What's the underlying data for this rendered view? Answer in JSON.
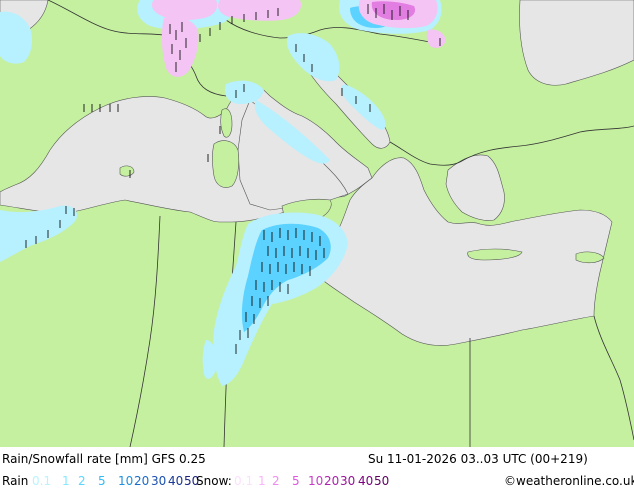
{
  "header": {
    "title": "Rain/Snowfall rate [mm] GFS 0.25",
    "datetime": "Su 11-01-2026 03..03 UTC (00+219)"
  },
  "legend": {
    "rain_label": "Rain",
    "rain_values": [
      "0.1",
      "1",
      "2",
      "5",
      "10",
      "20",
      "30",
      "40",
      "50"
    ],
    "rain_colors": [
      "#b8f4ff",
      "#8ae8ff",
      "#5cd6ff",
      "#33bbf5",
      "#1e90e0",
      "#1a6ccc",
      "#1a4fb0",
      "#1a3896",
      "#1a237e"
    ],
    "snow_label": "Snow:",
    "snow_values": [
      "0.1",
      "1",
      "2",
      "5",
      "10",
      "20",
      "30",
      "40",
      "50"
    ],
    "snow_colors": [
      "#fde0fd",
      "#f7b6f7",
      "#f08cf0",
      "#e055e0",
      "#c83ac8",
      "#b020b0",
      "#981098",
      "#7c007c",
      "#600060"
    ],
    "credit": "©weatheronline.co.uk"
  },
  "colors": {
    "sea": "#e6e6e6",
    "land": "#c5f0a0",
    "border": "#2f2f2f",
    "rain_light": "#b7f0ff",
    "rain_medium": "#5bd2ff",
    "snow_light": "#f4c4f4",
    "snow_medium": "#e27ee2"
  },
  "chart_data": {
    "type": "precipitation-map",
    "model": "GFS 0.25",
    "region": "Mediterranean"
  }
}
